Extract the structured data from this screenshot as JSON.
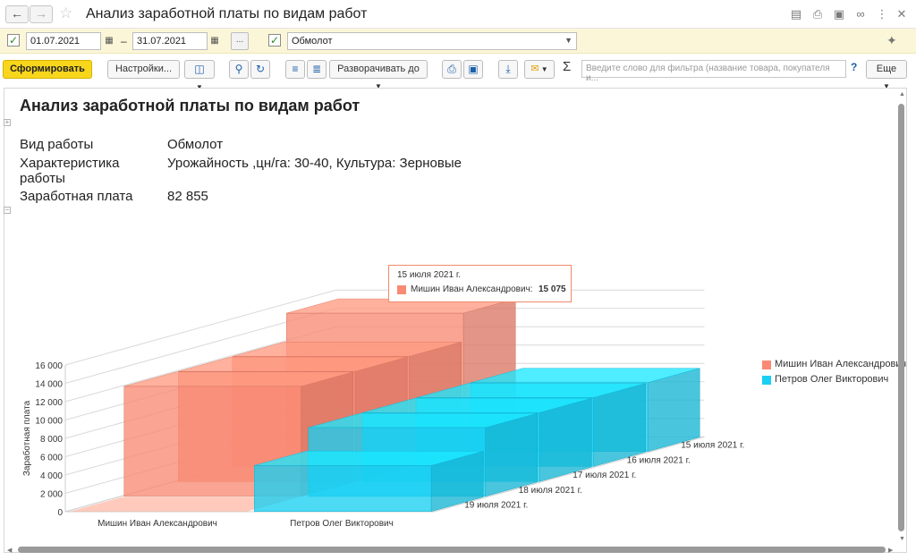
{
  "window": {
    "title": "Анализ заработной платы по видам работ",
    "back_icon": "arrow-left",
    "forward_icon": "arrow-right"
  },
  "filters": {
    "date_from": "01.07.2021",
    "date_sep": "–",
    "date_to": "31.07.2021",
    "more_label": "...",
    "work_type": "Обмолот"
  },
  "toolbar": {
    "generate_label": "Сформировать",
    "settings_label": "Настройки...",
    "expand_label": "Разворачивать до",
    "search_placeholder": "Введите слово для фильтра (название товара, покупателя и...",
    "help_label": "?",
    "more_label": "Еще",
    "sigma_label": "Σ"
  },
  "report": {
    "title": "Анализ заработной платы по видам работ",
    "rows": [
      {
        "label": "Вид работы",
        "value": "Обмолот"
      },
      {
        "label": "Характеристика работы",
        "value": "Урожайность ,цн/га: 30-40, Культура: Зерновые"
      },
      {
        "label": "Заработная плата",
        "value": "82 855"
      }
    ]
  },
  "tooltip": {
    "date": "15 июля 2021 г.",
    "series": "Мишин Иван Александрович:",
    "value": "15 075"
  },
  "chart_data": {
    "type": "bar",
    "ylabel": "Заработная плата",
    "ylim": [
      0,
      16000
    ],
    "yticks": [
      "0",
      "2 000",
      "4 000",
      "6 000",
      "8 000",
      "10 000",
      "12 000",
      "14 000",
      "16 000"
    ],
    "categories": [
      "Мишин Иван Александрович",
      "Петров Олег Викторович"
    ],
    "depth_categories": [
      "19 июля 2021 г.",
      "18 июля 2021 г.",
      "17 июля 2021 г.",
      "16 июля 2021 г.",
      "15 июля 2021 г."
    ],
    "series": [
      {
        "name": "Мишин Иван Александрович",
        "color": "#f98a74",
        "values": [
          0,
          12000,
          12000,
          12000,
          15075
        ]
      },
      {
        "name": "Петров Олег Викторович",
        "color": "#19cff2",
        "values": [
          5000,
          7500,
          7500,
          7500,
          7500
        ]
      }
    ],
    "legend_position": "right"
  }
}
